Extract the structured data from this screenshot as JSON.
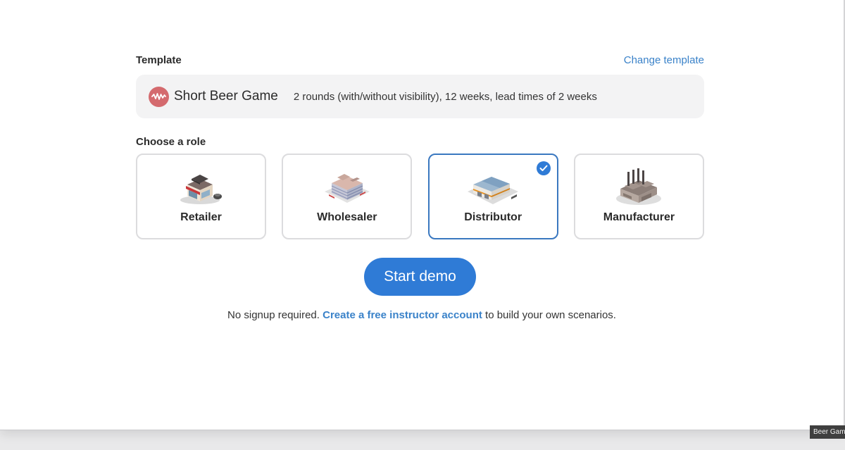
{
  "template_section": {
    "label": "Template",
    "change_link": "Change template",
    "name": "Short Beer Game",
    "description": "2 rounds (with/without visibility), 12 weeks, lead times of 2 weeks",
    "logo_icon": "waveform-icon",
    "logo_color": "#d46a6e"
  },
  "role_section": {
    "label": "Choose a role",
    "roles": [
      {
        "name": "Retailer",
        "icon": "retail-store-icon",
        "selected": false
      },
      {
        "name": "Wholesaler",
        "icon": "office-building-icon",
        "selected": false
      },
      {
        "name": "Distributor",
        "icon": "warehouse-icon",
        "selected": true
      },
      {
        "name": "Manufacturer",
        "icon": "factory-icon",
        "selected": false
      }
    ],
    "selected_check_icon": "checkmark-icon"
  },
  "actions": {
    "start_label": "Start demo"
  },
  "footer": {
    "prefix": "No signup required.",
    "link": "Create a free instructor account",
    "suffix": "to build your own scenarios."
  },
  "tooltip": {
    "text": "Beer Game"
  },
  "colors": {
    "accent": "#2f7bd6",
    "link": "#3a82c9",
    "selected_border": "#3a78c0"
  }
}
